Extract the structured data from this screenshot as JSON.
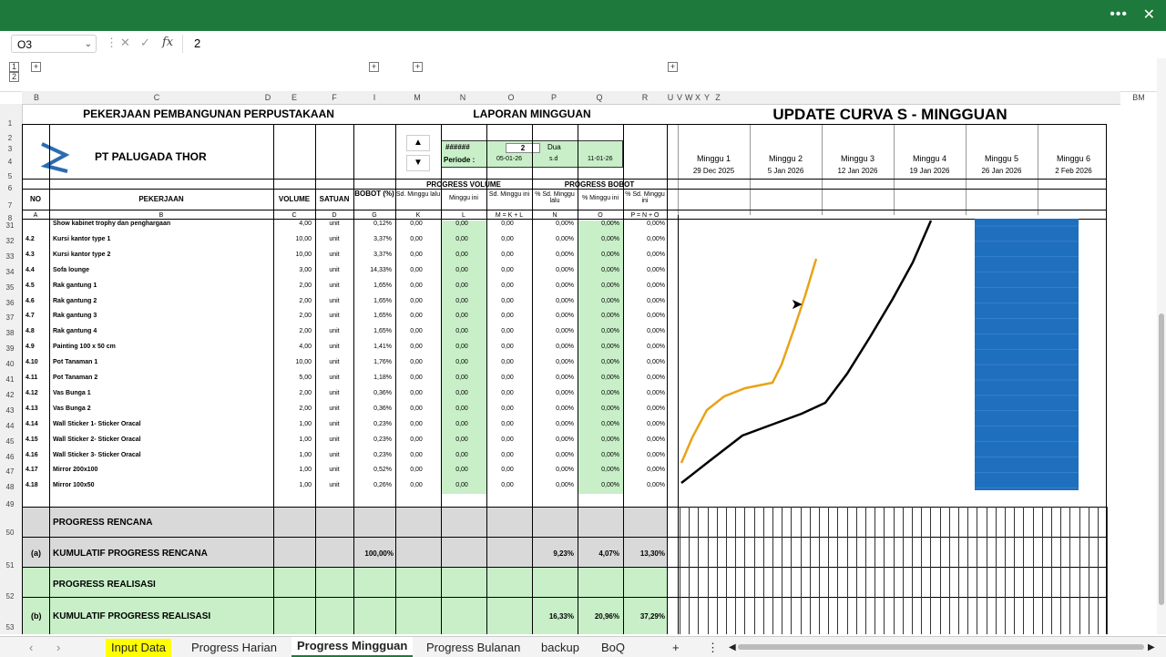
{
  "window": {
    "more_icon": "more-dots-icon",
    "close_icon": "close-x-icon"
  },
  "formula_bar": {
    "name_box": "O3",
    "value": "2",
    "fx": "fx"
  },
  "columns": [
    "B",
    "C",
    "D",
    "E",
    "F",
    "I",
    "M",
    "N",
    "O",
    "P",
    "Q",
    "R",
    "U",
    "V",
    "W",
    "X",
    "Y",
    "Z",
    "BM"
  ],
  "header": {
    "project_title": "PEKERJAAN PEMBANGUNAN PERPUSTAKAAN",
    "company": "PT PALUGADA THOR",
    "report_title": "LAPORAN MINGGUAN",
    "curve_title": "UPDATE CURVA S - MINGGUAN",
    "week_box": "######",
    "week_num": "2",
    "week_word": "Dua",
    "periode_label": "Periode :",
    "periode_start": "05-01-26",
    "periode_sd": "s.d",
    "periode_end": "11-01-26",
    "progress_volume": "PROGRESS VOLUME",
    "progress_bobot": "PROGRESS BOBOT",
    "col_no": "NO",
    "col_pekerjaan": "PEKERJAAN",
    "col_volume": "VOLUME",
    "col_satuan": "SATUAN",
    "col_bobot": "BOBOT (%)",
    "col_m": "Sd. Minggu lalu",
    "col_n": "Minggu ini",
    "col_o": "Sd. Minggu ini",
    "col_p": "% Sd. Minggu lalu",
    "col_q": "% Minggu ini",
    "col_r": "% Sd. Minggu ini",
    "code_a": "A",
    "code_b": "B",
    "code_c": "C",
    "code_d": "D",
    "code_g": "G",
    "code_k": "K",
    "code_l": "L",
    "code_mkl": "M = K + L",
    "code_n": "N",
    "code_o": "O",
    "code_pno": "P = N + O"
  },
  "weeks": [
    {
      "label": "Minggu 1",
      "date": "29 Dec 2025"
    },
    {
      "label": "Minggu 2",
      "date": "5 Jan 2026"
    },
    {
      "label": "Minggu 3",
      "date": "12 Jan 2026"
    },
    {
      "label": "Minggu 4",
      "date": "19 Jan 2026"
    },
    {
      "label": "Minggu 5",
      "date": "26 Jan 2026"
    },
    {
      "label": "Minggu 6",
      "date": "2 Feb 2026"
    }
  ],
  "rows": [
    {
      "r": "31",
      "no": "",
      "name": "Show kabinet trophy dan penghargaan",
      "vol": "4,00",
      "sat": "unit",
      "bobot": "0,12%"
    },
    {
      "r": "32",
      "no": "4.2",
      "name": "Kursi kantor type 1",
      "vol": "10,00",
      "sat": "unit",
      "bobot": "3,37%"
    },
    {
      "r": "33",
      "no": "4.3",
      "name": "Kursi kantor type 2",
      "vol": "10,00",
      "sat": "unit",
      "bobot": "3,37%"
    },
    {
      "r": "34",
      "no": "4.4",
      "name": "Sofa lounge",
      "vol": "3,00",
      "sat": "unit",
      "bobot": "14,33%"
    },
    {
      "r": "35",
      "no": "4.5",
      "name": "Rak gantung 1",
      "vol": "2,00",
      "sat": "unit",
      "bobot": "1,65%"
    },
    {
      "r": "36",
      "no": "4.6",
      "name": "Rak gantung 2",
      "vol": "2,00",
      "sat": "unit",
      "bobot": "1,65%"
    },
    {
      "r": "37",
      "no": "4.7",
      "name": "Rak gantung 3",
      "vol": "2,00",
      "sat": "unit",
      "bobot": "1,65%"
    },
    {
      "r": "38",
      "no": "4.8",
      "name": "Rak gantung 4",
      "vol": "2,00",
      "sat": "unit",
      "bobot": "1,65%"
    },
    {
      "r": "39",
      "no": "4.9",
      "name": "Painting 100 x 50 cm",
      "vol": "4,00",
      "sat": "unit",
      "bobot": "1,41%"
    },
    {
      "r": "40",
      "no": "4.10",
      "name": "Pot Tanaman 1",
      "vol": "10,00",
      "sat": "unit",
      "bobot": "1,76%"
    },
    {
      "r": "41",
      "no": "4.11",
      "name": "Pot Tanaman 2",
      "vol": "5,00",
      "sat": "unit",
      "bobot": "1,18%"
    },
    {
      "r": "42",
      "no": "4.12",
      "name": "Vas Bunga 1",
      "vol": "2,00",
      "sat": "unit",
      "bobot": "0,36%"
    },
    {
      "r": "43",
      "no": "4.13",
      "name": "Vas Bunga 2",
      "vol": "2,00",
      "sat": "unit",
      "bobot": "0,36%"
    },
    {
      "r": "44",
      "no": "4.14",
      "name": "Wall Sticker 1- Sticker Oracal",
      "vol": "1,00",
      "sat": "unit",
      "bobot": "0,23%"
    },
    {
      "r": "45",
      "no": "4.15",
      "name": "Wall Sticker 2- Sticker Oracal",
      "vol": "1,00",
      "sat": "unit",
      "bobot": "0,23%"
    },
    {
      "r": "46",
      "no": "4.16",
      "name": "Wall Sticker 3- Sticker Oracal",
      "vol": "1,00",
      "sat": "unit",
      "bobot": "0,23%"
    },
    {
      "r": "47",
      "no": "4.17",
      "name": "Mirror 200x100",
      "vol": "1,00",
      "sat": "unit",
      "bobot": "0,52%"
    },
    {
      "r": "48",
      "no": "4.18",
      "name": "Mirror 100x50",
      "vol": "1,00",
      "sat": "unit",
      "bobot": "0,26%"
    }
  ],
  "zero": "0,00",
  "zero_pct": "0,00%",
  "summary": {
    "rencana": "PROGRESS RENCANA",
    "kum_rencana_code": "(a)",
    "kum_rencana": "KUMULATIF PROGRESS RENCANA",
    "kum_rencana_bobot": "100,00%",
    "kum_rencana_p": "9,23%",
    "kum_rencana_q": "4,07%",
    "kum_rencana_r": "13,30%",
    "realisasi": "PROGRESS REALISASI",
    "kum_realisasi_code": "(b)",
    "kum_realisasi": "KUMULATIF PROGRESS REALISASI",
    "kum_realisasi_p": "16,33%",
    "kum_realisasi_q": "20,96%",
    "kum_realisasi_r": "37,29%"
  },
  "sheet_tabs": [
    "Input Data",
    "Progress Harian",
    "Progress Mingguan",
    "Progress Bulanan",
    "backup",
    "BoQ"
  ],
  "active_tab": "Progress Mingguan",
  "colors": {
    "green_header": "#1e7a3c",
    "realisasi_line": "#e8a317",
    "rencana_line": "#000000",
    "block": "#1f6fbf",
    "green_fill": "#c8efc8"
  }
}
